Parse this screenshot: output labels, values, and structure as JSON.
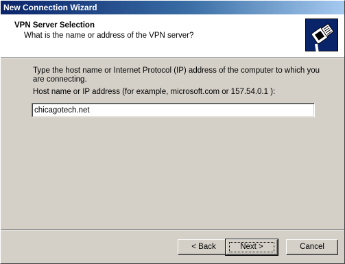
{
  "window": {
    "title": "New Connection Wizard"
  },
  "header": {
    "title": "VPN Server Selection",
    "subtitle": "What is the name or address of the VPN server?",
    "icon": "network-cable-plug-icon"
  },
  "main": {
    "description": "Type the host name or Internet Protocol (IP) address of the computer to which you are connecting.",
    "host_label": "Host name or IP address (for example, microsoft.com or 157.54.0.1 ):",
    "host_value": "chicagotech.net"
  },
  "buttons": {
    "back_label": "< Back",
    "next_label": "Next >",
    "cancel_label": "Cancel"
  },
  "colors": {
    "titlebar_start": "#0a246a",
    "titlebar_end": "#a6caf0",
    "dialog_face": "#d4d0c8"
  }
}
